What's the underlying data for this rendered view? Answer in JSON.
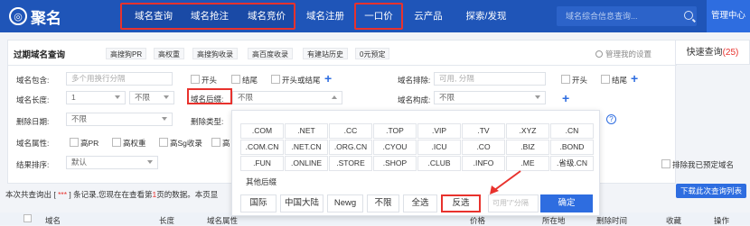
{
  "header": {
    "logo_mark": "◎",
    "logo_text": "聚名",
    "nav": [
      "域名查询",
      "域名抢注",
      "域名竞价",
      "域名注册",
      "一口价",
      "云产品",
      "探索/发现"
    ],
    "search_placeholder": "域名综合信息查询...",
    "manage_center": "管理中心"
  },
  "panel": {
    "title": "过期域名查询",
    "tags": [
      "高搜狗PR",
      "高权重",
      "高搜狗收录",
      "高百度收录",
      "有建站历史",
      "0元预定"
    ],
    "manage_settings": "管理我的设置",
    "quick_query": "快速查询",
    "quick_count": "(25)"
  },
  "form": {
    "contains_label": "域名包含:",
    "contains_placeholder": "多个用换行分隔",
    "opt_start": "开头",
    "opt_end": "结尾",
    "opt_start_or_end": "开头或结尾",
    "exclude_label": "域名排除:",
    "exclude_placeholder": "可用, 分隔",
    "exclude_start": "开头",
    "exclude_end": "结尾",
    "length_label": "域名长度:",
    "length_from": "1",
    "length_to": "不限",
    "suffix_label": "域名后缀:",
    "suffix_value": "不限",
    "structure_label": "域名构成:",
    "structure_value": "不限",
    "delete_date_label": "删除日期:",
    "delete_date_value": "不限",
    "delete_type_label": "删除类型:",
    "attr_label": "域名属性:",
    "attr_pr": "高PR",
    "attr_weight": "高权重",
    "attr_sg": "高Sg收录",
    "attr_more": "高",
    "sort_label": "结果排序:",
    "sort_value": "默认",
    "exclude_reserved": "排除我已预定域名"
  },
  "dropdown": {
    "suffixes": [
      ".COM",
      ".NET",
      ".CC",
      ".TOP",
      ".VIP",
      ".TV",
      ".XYZ",
      ".CN",
      ".COM.CN",
      ".NET.CN",
      ".ORG.CN",
      ".CYOU",
      ".ICU",
      ".CO",
      ".BIZ",
      ".BOND",
      ".FUN",
      ".ONLINE",
      ".STORE",
      ".SHOP",
      ".CLUB",
      ".INFO",
      ".ME",
      ".省级.CN"
    ],
    "other": "其他后缀",
    "buttons": [
      "国际",
      "中国大陆",
      "Newg",
      "不限",
      "全选",
      "反选"
    ],
    "price_placeholder": "可用\"/\"分隔",
    "confirm": "确定"
  },
  "result": {
    "prefix": "本次共查询出 [",
    "count": " *** ",
    "middle": "] 条记录,您现在在查看第",
    "page": "1",
    "suffix": "页的数据。本页显",
    "download": "下载此次查询列表"
  },
  "table_head": [
    "域名",
    "长度",
    "域名属性",
    "价格",
    "所在地",
    "删除时间",
    "收藏",
    "操作"
  ]
}
